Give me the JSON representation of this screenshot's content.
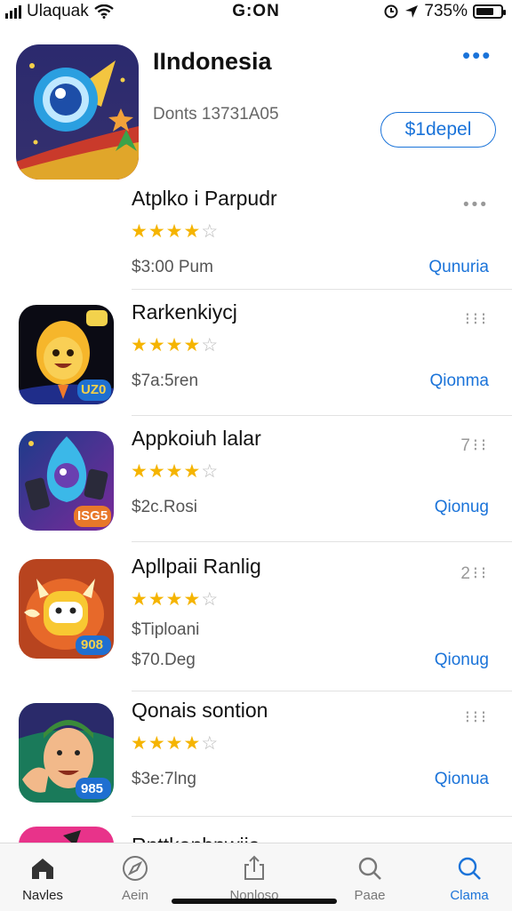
{
  "status_bar": {
    "carrier": "Ulaquak",
    "time": "G:ON",
    "battery": "735%",
    "battery_level": 0.73
  },
  "header": {
    "title": "IIndonesia",
    "subtitle": "Donts 13731A05",
    "button_label": "$1depel",
    "more_icon": "more-icon"
  },
  "first_item": {
    "title": "Atplko i Parpudr",
    "rating": 4,
    "price": "$3:00 Pum",
    "link": "Qunuria"
  },
  "apps": [
    {
      "title": "Rarkenkiycj",
      "rating": 4,
      "price": "$7a:5ren",
      "link": "Qionma",
      "badge": "UZ0",
      "menu": ""
    },
    {
      "title": "Appkoiuh lalar",
      "rating": 4,
      "price": "$2c.Rosi",
      "link": "Qionug",
      "badge": "ISG5",
      "menu": "7"
    },
    {
      "title": "Apllpaii Ranlig",
      "rating": 4,
      "sub": "$Tiploani",
      "price": "$70.Deg",
      "link": "Qionug",
      "badge": "908",
      "menu": "2"
    },
    {
      "title": "Qonais sontion",
      "rating": 4,
      "price": "$3e:7lng",
      "link": "Qionua",
      "badge": "985",
      "menu": ""
    }
  ],
  "partial_row": {
    "title": "Rnttkanbnwiia"
  },
  "tabs": [
    {
      "label": "Navles",
      "icon": "home-icon"
    },
    {
      "label": "Aein",
      "icon": "compass-icon"
    },
    {
      "label": "Nonloso",
      "icon": "share-icon"
    },
    {
      "label": "Paae",
      "icon": "search-icon"
    },
    {
      "label": "Clama",
      "icon": "search-icon"
    }
  ],
  "colors": {
    "accent": "#1a73d9",
    "star": "#f5b400"
  }
}
